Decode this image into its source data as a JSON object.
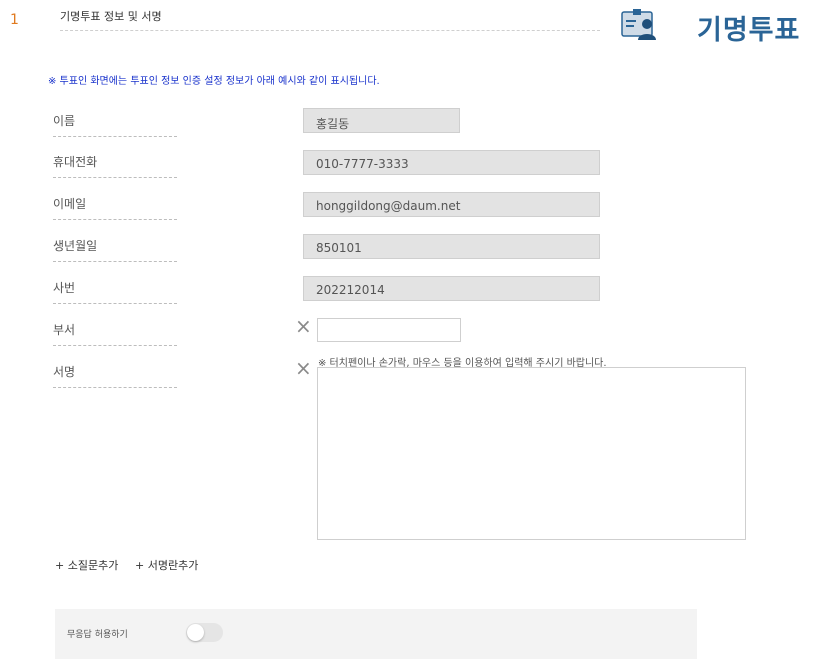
{
  "question": {
    "number": "1",
    "title": "기명투표 정보 및 서명"
  },
  "badge": {
    "icon": "id-card-person-icon",
    "text": "기명투표",
    "color": "#2a6496"
  },
  "notice": "※ 투표인 화면에는 투표인 정보 인증 설정 정보가 아래 예시와 같이 표시됩니다.",
  "fields": [
    {
      "label": "이름",
      "value": "홍길동"
    },
    {
      "label": "휴대전화",
      "value": "010-7777-3333"
    },
    {
      "label": "이메일",
      "value": "honggildong@daum.net"
    },
    {
      "label": "생년월일",
      "value": "850101"
    },
    {
      "label": "사번",
      "value": "202212014"
    },
    {
      "label": "부서",
      "value": ""
    },
    {
      "label": "서명",
      "value": ""
    }
  ],
  "signature": {
    "note": "※ 터치펜이나 손가락, 마우스 등을 이용하여 입력해 주시기 바랍니다."
  },
  "actions": {
    "add_question": "+ 소질문추가",
    "add_signature": "+ 서명란추가"
  },
  "bottom": {
    "toggle_label": "무응답 허용하기",
    "toggle_on": false
  },
  "colors": {
    "question_number": "#e07a1f",
    "notice": "#1a33cc",
    "readonly_field_bg": "#e3e3e3"
  }
}
